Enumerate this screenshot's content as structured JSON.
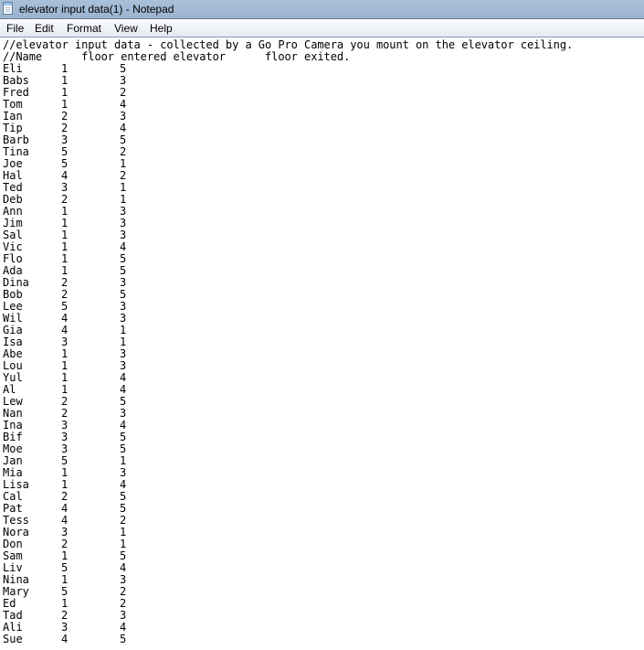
{
  "window": {
    "title": "elevator input data(1) - Notepad",
    "icon": "notepad-icon"
  },
  "menu": [
    "File",
    "Edit",
    "Format",
    "View",
    "Help"
  ],
  "document": {
    "header_lines": [
      "//elevator input data - collected by a Go Pro Camera you mount on the elevator ceiling.",
      "//Name      floor entered elevator      floor exited."
    ],
    "rows": [
      {
        "name": "Eli",
        "entered": "1",
        "exited": "5"
      },
      {
        "name": "Babs",
        "entered": "1",
        "exited": "3"
      },
      {
        "name": "Fred",
        "entered": "1",
        "exited": "2"
      },
      {
        "name": "Tom",
        "entered": "1",
        "exited": "4"
      },
      {
        "name": "Ian",
        "entered": "2",
        "exited": "3"
      },
      {
        "name": "Tip",
        "entered": "2",
        "exited": "4"
      },
      {
        "name": "Barb",
        "entered": "3",
        "exited": "5"
      },
      {
        "name": "Tina",
        "entered": "5",
        "exited": "2"
      },
      {
        "name": "Joe",
        "entered": "5",
        "exited": "1"
      },
      {
        "name": "Hal",
        "entered": "4",
        "exited": "2"
      },
      {
        "name": "Ted",
        "entered": "3",
        "exited": "1"
      },
      {
        "name": "Deb",
        "entered": "2",
        "exited": "1"
      },
      {
        "name": "Ann",
        "entered": "1",
        "exited": "3"
      },
      {
        "name": "Jim",
        "entered": "1",
        "exited": "3"
      },
      {
        "name": "Sal",
        "entered": "1",
        "exited": "3"
      },
      {
        "name": "Vic",
        "entered": "1",
        "exited": "4"
      },
      {
        "name": "Flo",
        "entered": "1",
        "exited": "5"
      },
      {
        "name": "Ada",
        "entered": "1",
        "exited": "5"
      },
      {
        "name": "Dina",
        "entered": "2",
        "exited": "3"
      },
      {
        "name": "Bob",
        "entered": "2",
        "exited": "5"
      },
      {
        "name": "Lee",
        "entered": "5",
        "exited": "3"
      },
      {
        "name": "Wil",
        "entered": "4",
        "exited": "3"
      },
      {
        "name": "Gia",
        "entered": "4",
        "exited": "1"
      },
      {
        "name": "Isa",
        "entered": "3",
        "exited": "1"
      },
      {
        "name": "Abe",
        "entered": "1",
        "exited": "3"
      },
      {
        "name": "Lou",
        "entered": "1",
        "exited": "3"
      },
      {
        "name": "Yul",
        "entered": "1",
        "exited": "4"
      },
      {
        "name": "Al",
        "entered": "1",
        "exited": "4"
      },
      {
        "name": "Lew",
        "entered": "2",
        "exited": "5"
      },
      {
        "name": "Nan",
        "entered": "2",
        "exited": "3"
      },
      {
        "name": "Ina",
        "entered": "3",
        "exited": "4"
      },
      {
        "name": "Bif",
        "entered": "3",
        "exited": "5"
      },
      {
        "name": "Moe",
        "entered": "3",
        "exited": "5"
      },
      {
        "name": "Jan",
        "entered": "5",
        "exited": "1"
      },
      {
        "name": "Mia",
        "entered": "1",
        "exited": "3"
      },
      {
        "name": "Lisa",
        "entered": "1",
        "exited": "4"
      },
      {
        "name": "Cal",
        "entered": "2",
        "exited": "5"
      },
      {
        "name": "Pat",
        "entered": "4",
        "exited": "5"
      },
      {
        "name": "Tess",
        "entered": "4",
        "exited": "2"
      },
      {
        "name": "Nora",
        "entered": "3",
        "exited": "1"
      },
      {
        "name": "Don",
        "entered": "2",
        "exited": "1"
      },
      {
        "name": "Sam",
        "entered": "1",
        "exited": "5"
      },
      {
        "name": "Liv",
        "entered": "5",
        "exited": "4"
      },
      {
        "name": "Nina",
        "entered": "1",
        "exited": "3"
      },
      {
        "name": "Mary",
        "entered": "5",
        "exited": "2"
      },
      {
        "name": "Ed",
        "entered": "1",
        "exited": "2"
      },
      {
        "name": "Tad",
        "entered": "2",
        "exited": "3"
      },
      {
        "name": "Ali",
        "entered": "3",
        "exited": "4"
      },
      {
        "name": "Sue",
        "entered": "4",
        "exited": "5"
      }
    ]
  }
}
